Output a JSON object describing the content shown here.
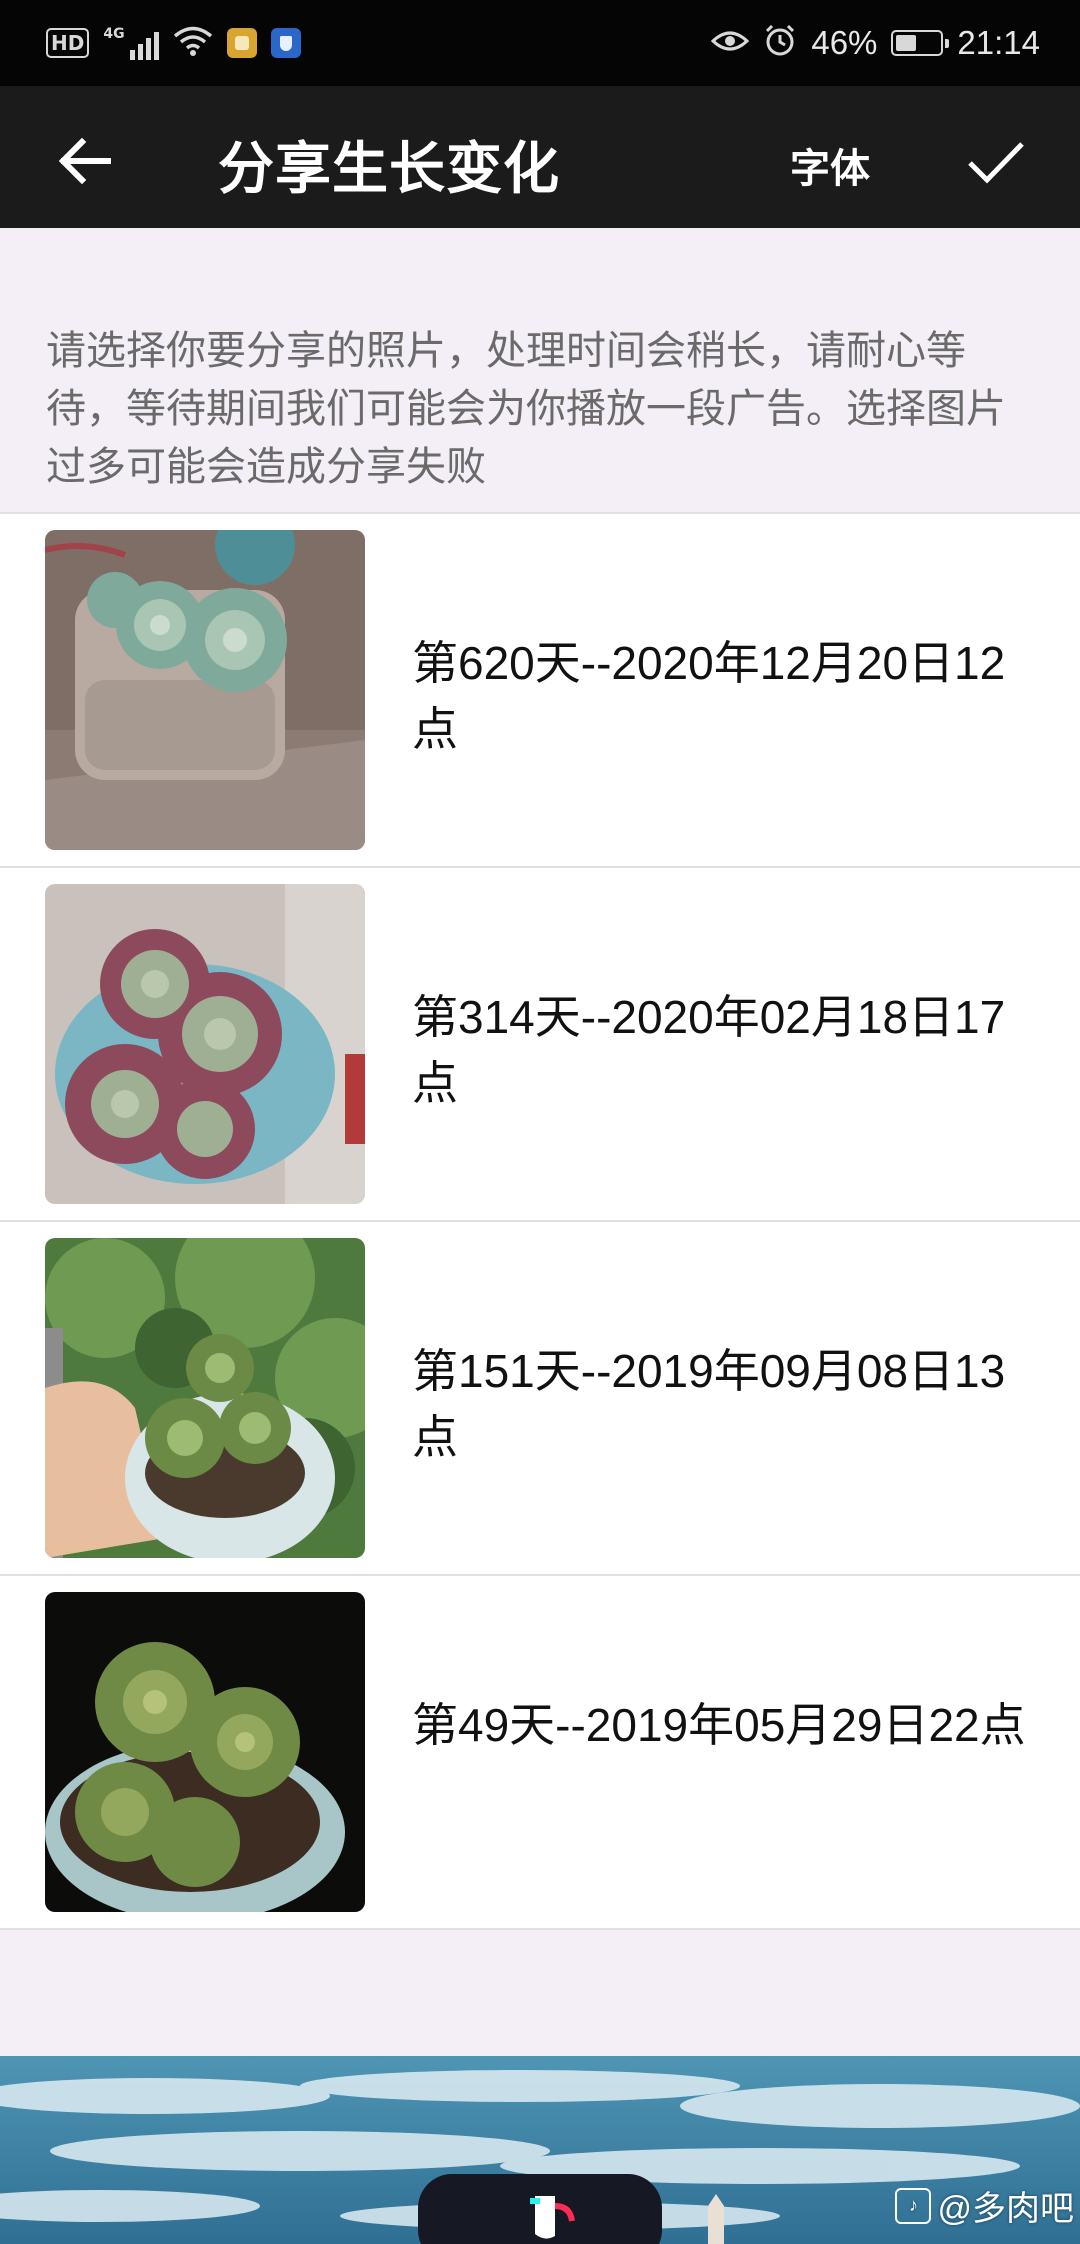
{
  "status_bar": {
    "hd": "HD",
    "network": "4G",
    "battery_percent": "46%",
    "battery_level": 0.46,
    "time": "21:14"
  },
  "header": {
    "title": "分享生长变化",
    "font_label": "字体"
  },
  "hint": "请选择你要分享的照片，处理时间会稍长，请耐心等待，等待期间我们可能会为你播放一段广告。选择图片过多可能会造成分享失败",
  "photos": [
    {
      "caption": "第620天--2020年12月20日12点"
    },
    {
      "caption": "第314天--2020年02月18日17点"
    },
    {
      "caption": "第151天--2019年09月08日13点"
    },
    {
      "caption": "第49天--2019年05月29日22点"
    }
  ],
  "banner": {
    "watermark": "@多肉吧"
  },
  "colors": {
    "status_bar_bg": "#050505",
    "app_bar_bg": "#1b1b1b",
    "page_bg": "#f4eff6",
    "hint_text": "#6a6a6a"
  }
}
